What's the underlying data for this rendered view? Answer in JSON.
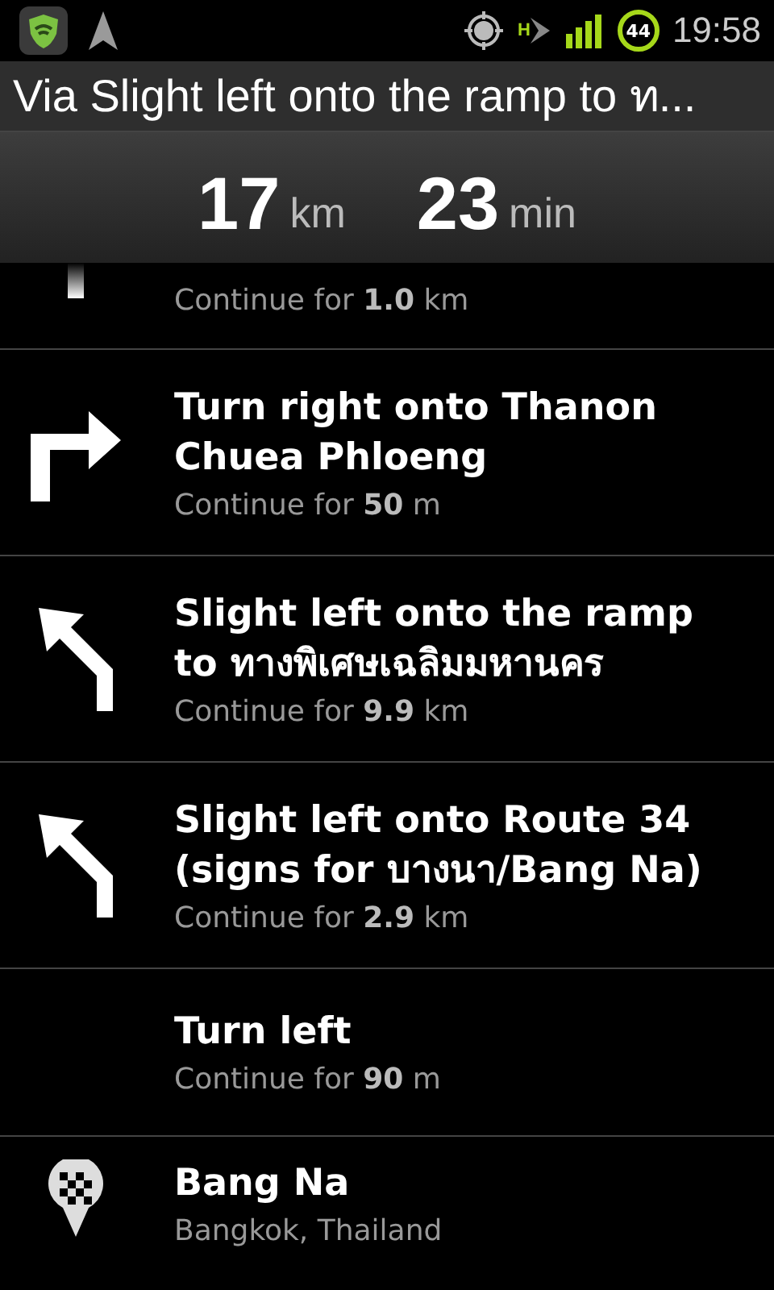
{
  "status_bar": {
    "time": "19:58",
    "notification_count": "44",
    "network": "H"
  },
  "route": {
    "via": "Via Slight left onto the ramp to ท...",
    "distance": "17",
    "distance_unit": "km",
    "duration": "23",
    "duration_unit": "min"
  },
  "steps": [
    {
      "kind": "straight",
      "detail": "Continue for **1.0** km"
    },
    {
      "kind": "right",
      "instruction": "Turn right onto Thanon Chuea Phloeng",
      "detail": "Continue for **50** m"
    },
    {
      "kind": "slight-left",
      "instruction": "Slight left onto the ramp to ทางพิเศษเฉลิมมหานคร",
      "detail": "Continue for **9.9** km"
    },
    {
      "kind": "slight-left",
      "instruction": "Slight left onto Route 34 (signs for บางนา/Bang Na)",
      "detail": "Continue for **2.9** km"
    },
    {
      "kind": "none",
      "instruction": "Turn left",
      "detail": "Continue for **90** m"
    },
    {
      "kind": "destination",
      "instruction": "Bang Na",
      "detail": "Bangkok, Thailand"
    }
  ]
}
